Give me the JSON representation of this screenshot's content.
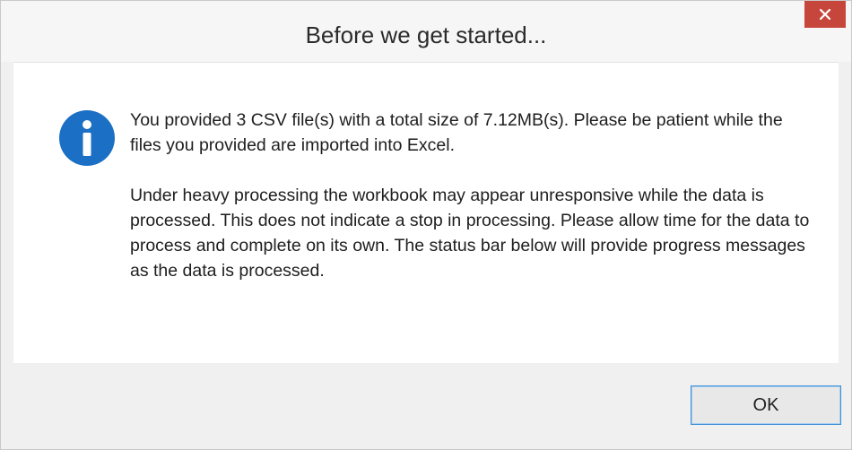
{
  "dialog": {
    "title": "Before we get started...",
    "icon": "info-icon",
    "message_paragraph_1": "You provided 3 CSV file(s) with a total size of 7.12MB(s). Please be patient while the files you provided are imported into Excel.",
    "message_paragraph_2": "Under heavy processing the workbook may appear unresponsive while the data is processed. This does not indicate a stop in processing. Please allow time for the data to process and complete on its own. The status bar below will provide progress messages as the data is processed.",
    "ok_label": "OK",
    "close_icon": "close-icon"
  },
  "colors": {
    "close_button_bg": "#c7463b",
    "info_icon_blue": "#1b6fc4",
    "ok_border": "#3c8fd6"
  }
}
